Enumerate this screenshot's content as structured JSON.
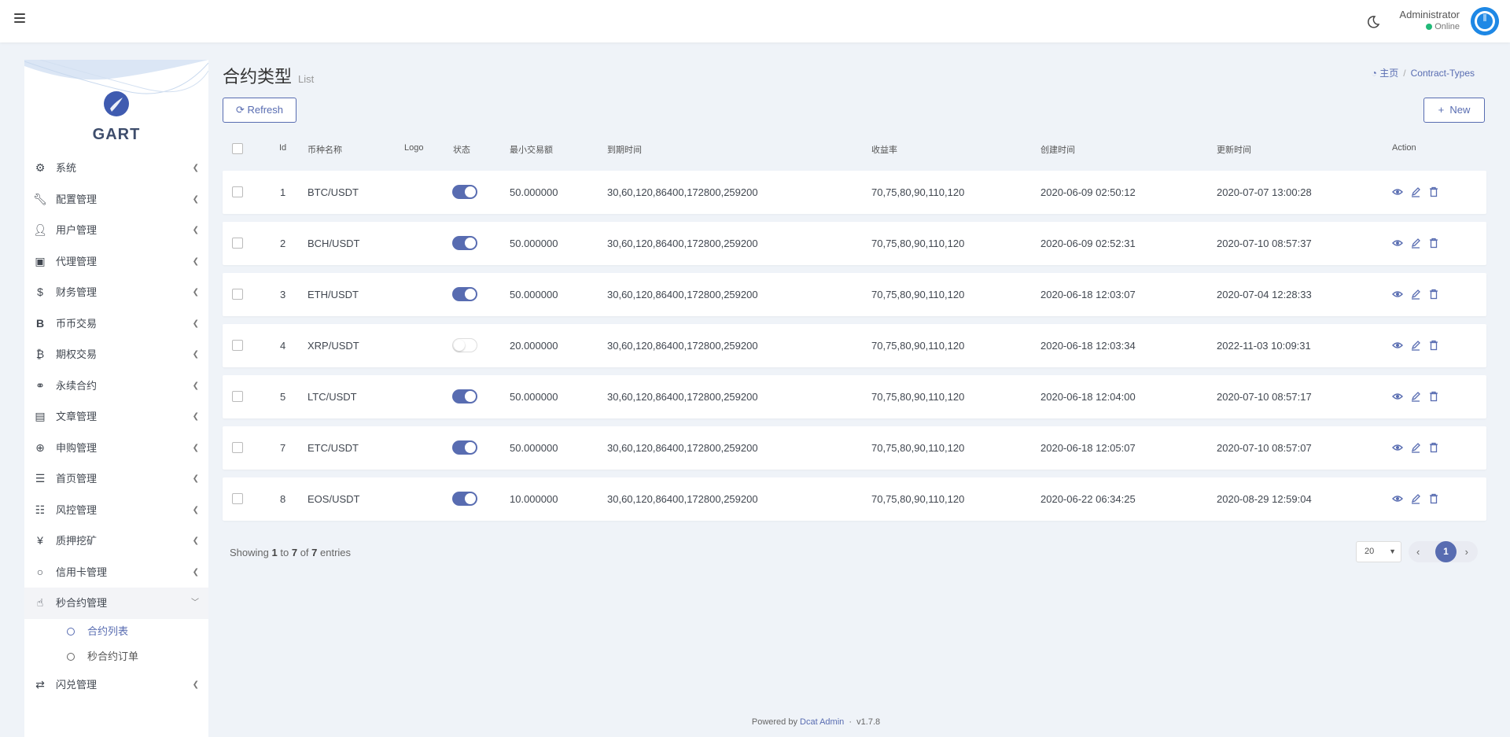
{
  "navbar": {
    "user_name": "Administrator",
    "user_status": "Online"
  },
  "sidebar": {
    "brand": "GART",
    "items": [
      {
        "label": "系统",
        "icon": "gear-icon"
      },
      {
        "label": "配置管理",
        "icon": "wrench-icon"
      },
      {
        "label": "用户管理",
        "icon": "user-icon"
      },
      {
        "label": "代理管理",
        "icon": "id-card-icon"
      },
      {
        "label": "财务管理",
        "icon": "dollar-icon"
      },
      {
        "label": "币币交易",
        "icon": "bitcoin-b-icon"
      },
      {
        "label": "期权交易",
        "icon": "bitcoin-icon"
      },
      {
        "label": "永续合约",
        "icon": "link-icon"
      },
      {
        "label": "文章管理",
        "icon": "newspaper-icon"
      },
      {
        "label": "申购管理",
        "icon": "life-ring-icon"
      },
      {
        "label": "首页管理",
        "icon": "list-icon"
      },
      {
        "label": "风控管理",
        "icon": "indent-list-icon"
      },
      {
        "label": "质押挖矿",
        "icon": "yen-icon"
      },
      {
        "label": "信用卡管理",
        "icon": "circle-icon"
      },
      {
        "label": "秒合约管理",
        "icon": "fingerprint-icon"
      }
    ],
    "submenu": [
      {
        "label": "合约列表"
      },
      {
        "label": "秒合约订单"
      }
    ],
    "last_item": {
      "label": "闪兑管理",
      "icon": "exchange-icon"
    }
  },
  "page": {
    "title": "合约类型",
    "subtitle": "List",
    "breadcrumb_home": "主页",
    "breadcrumb_current": "Contract-Types",
    "refresh_label": "Refresh",
    "new_label": "New"
  },
  "table": {
    "headers": [
      "Id",
      "币种名称",
      "Logo",
      "状态",
      "最小交易额",
      "到期时间",
      "收益率",
      "创建时间",
      "更新时间",
      "Action"
    ],
    "rows": [
      {
        "id": "1",
        "name": "BTC/USDT",
        "status": true,
        "min": "50.000000",
        "expiry": "30,60,120,86400,172800,259200",
        "rate": "70,75,80,90,110,120",
        "created": "2020-06-09 02:50:12",
        "updated": "2020-07-07 13:00:28"
      },
      {
        "id": "2",
        "name": "BCH/USDT",
        "status": true,
        "min": "50.000000",
        "expiry": "30,60,120,86400,172800,259200",
        "rate": "70,75,80,90,110,120",
        "created": "2020-06-09 02:52:31",
        "updated": "2020-07-10 08:57:37"
      },
      {
        "id": "3",
        "name": "ETH/USDT",
        "status": true,
        "min": "50.000000",
        "expiry": "30,60,120,86400,172800,259200",
        "rate": "70,75,80,90,110,120",
        "created": "2020-06-18 12:03:07",
        "updated": "2020-07-04 12:28:33"
      },
      {
        "id": "4",
        "name": "XRP/USDT",
        "status": false,
        "min": "20.000000",
        "expiry": "30,60,120,86400,172800,259200",
        "rate": "70,75,80,90,110,120",
        "created": "2020-06-18 12:03:34",
        "updated": "2022-11-03 10:09:31"
      },
      {
        "id": "5",
        "name": "LTC/USDT",
        "status": true,
        "min": "50.000000",
        "expiry": "30,60,120,86400,172800,259200",
        "rate": "70,75,80,90,110,120",
        "created": "2020-06-18 12:04:00",
        "updated": "2020-07-10 08:57:17"
      },
      {
        "id": "7",
        "name": "ETC/USDT",
        "status": true,
        "min": "50.000000",
        "expiry": "30,60,120,86400,172800,259200",
        "rate": "70,75,80,90,110,120",
        "created": "2020-06-18 12:05:07",
        "updated": "2020-07-10 08:57:07"
      },
      {
        "id": "8",
        "name": "EOS/USDT",
        "status": true,
        "min": "10.000000",
        "expiry": "30,60,120,86400,172800,259200",
        "rate": "70,75,80,90,110,120",
        "created": "2020-06-22 06:34:25",
        "updated": "2020-08-29 12:59:04"
      }
    ]
  },
  "pagination": {
    "showing_prefix": "Showing",
    "from": "1",
    "to_word": "to",
    "to": "7",
    "of_word": "of",
    "total": "7",
    "entries_word": "entries",
    "per_page": "20",
    "current_page": "1"
  },
  "footer": {
    "prefix": "Powered by",
    "link": "Dcat Admin",
    "version": "v1.7.8"
  },
  "colors": {
    "primary": "#586cb1",
    "online": "#21b978"
  }
}
